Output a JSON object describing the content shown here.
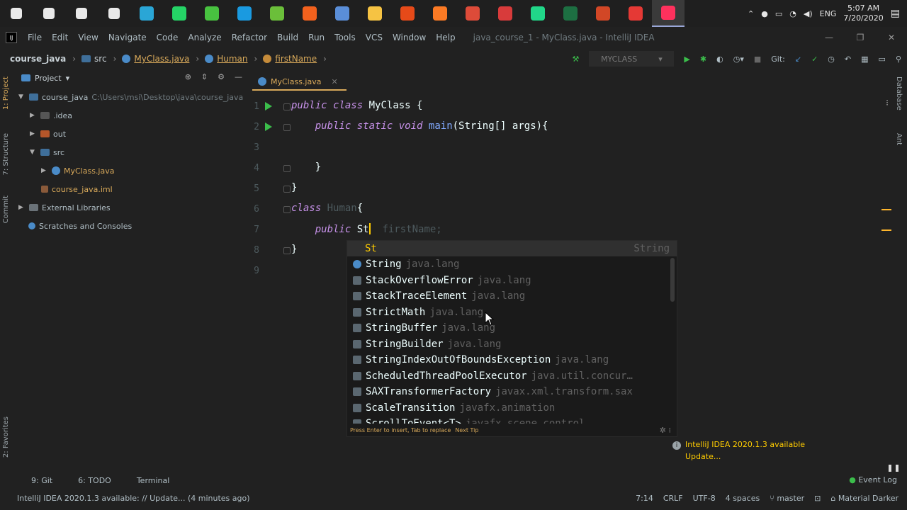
{
  "taskbar": {
    "apps": [
      {
        "name": "windows-start-icon",
        "color": "#ffffff"
      },
      {
        "name": "search-icon",
        "color": "#ffffff"
      },
      {
        "name": "cortana-icon",
        "color": "#ffffff"
      },
      {
        "name": "task-view-icon",
        "color": "#ffffff"
      },
      {
        "name": "app-e-icon",
        "color": "#2aa6d6"
      },
      {
        "name": "whatsapp-icon",
        "color": "#25d366"
      },
      {
        "name": "app-ring-icon",
        "color": "#48c240"
      },
      {
        "name": "skype-icon",
        "color": "#1a9ae0"
      },
      {
        "name": "app-green-icon",
        "color": "#6bbf3a"
      },
      {
        "name": "app-orange-icon",
        "color": "#f2611d"
      },
      {
        "name": "app-cube-icon",
        "color": "#5a8ed8"
      },
      {
        "name": "file-explorer-icon",
        "color": "#f6c343"
      },
      {
        "name": "office-icon",
        "color": "#e64a19"
      },
      {
        "name": "xampp-icon",
        "color": "#fb7a24"
      },
      {
        "name": "chrome-icon",
        "color": "#dd4b39"
      },
      {
        "name": "app-bolt-icon",
        "color": "#d83b3b"
      },
      {
        "name": "webstorm-icon",
        "color": "#21d789"
      },
      {
        "name": "excel-icon",
        "color": "#1d6f42"
      },
      {
        "name": "powerpoint-icon",
        "color": "#d24726"
      },
      {
        "name": "app-red-icon",
        "color": "#e53935"
      },
      {
        "name": "intellij-icon",
        "color": "#fe315d"
      }
    ],
    "language": "ENG",
    "time": "5:07 AM",
    "date": "7/20/2020"
  },
  "menubar": {
    "items": [
      "File",
      "Edit",
      "View",
      "Navigate",
      "Code",
      "Analyze",
      "Refactor",
      "Build",
      "Run",
      "Tools",
      "VCS",
      "Window",
      "Help"
    ],
    "window_title": "java_course_1 - MyClass.java - IntelliJ IDEA"
  },
  "navbar": {
    "crumbs": [
      "course_java",
      "src",
      "MyClass.java",
      "Human",
      "firstName"
    ],
    "run_config": "MYCLASS",
    "git_label": "Git:"
  },
  "left_tabs": [
    "1: Project",
    "7: Structure",
    "Commit",
    "2: Favorites"
  ],
  "right_tabs": [
    "Database",
    "Ant"
  ],
  "project": {
    "title": "Project",
    "root_name": "course_java",
    "root_path": "C:\\Users\\msi\\Desktop\\java\\course_java",
    "nodes": [
      ".idea",
      "out",
      "src",
      "MyClass.java",
      "course_java.iml",
      "External Libraries",
      "Scratches and Consoles"
    ]
  },
  "editor": {
    "tab": "MyClass.java",
    "line_numbers": [
      "1",
      "2",
      "3",
      "4",
      "5",
      "6",
      "7",
      "8",
      "9"
    ],
    "code": {
      "l1_kw1": "public",
      "l1_kw2": "class",
      "l1_rest": " MyClass {",
      "l2_kw1": "public",
      "l2_kw2": "static",
      "l2_kw3": "void",
      "l2_fn": "main",
      "l2_rest": "(String[] args){",
      "l4": "}",
      "l5": "}",
      "l6_kw": "class",
      "l6_name": "Human",
      "l6_rest": "{",
      "l7_kw": "public",
      "l7_typed": "St",
      "l7_hint": "firstName;",
      "l8": "}"
    }
  },
  "completion": {
    "typed": "St",
    "typed_type": "String",
    "items": [
      {
        "name": "String",
        "pkg": "java.lang"
      },
      {
        "name": "StackOverflowError",
        "pkg": "java.lang"
      },
      {
        "name": "StackTraceElement",
        "pkg": "java.lang"
      },
      {
        "name": "StrictMath",
        "pkg": "java.lang"
      },
      {
        "name": "StringBuffer",
        "pkg": "java.lang"
      },
      {
        "name": "StringBuilder",
        "pkg": "java.lang"
      },
      {
        "name": "StringIndexOutOfBoundsException",
        "pkg": "java.lang"
      },
      {
        "name": "ScheduledThreadPoolExecutor",
        "pkg": "java.util.concur…"
      },
      {
        "name": "SAXTransformerFactory",
        "pkg": "javax.xml.transform.sax"
      },
      {
        "name": "ScaleTransition",
        "pkg": "javafx.animation"
      },
      {
        "name": "ScrollToEvent<T>",
        "pkg": "javafx.scene.control"
      }
    ],
    "footer_hint": "Press Enter to insert, Tab to replace",
    "footer_link": "Next Tip"
  },
  "notification": {
    "title": "IntelliJ IDEA 2020.1.3 available",
    "action": "Update..."
  },
  "bottom_tools": [
    "9: Git",
    "6: TODO",
    "Terminal"
  ],
  "event_log": "Event Log",
  "status": {
    "message": "IntelliJ IDEA 2020.1.3 available: // Update... (4 minutes ago)",
    "position": "7:14",
    "line_sep": "CRLF",
    "encoding": "UTF-8",
    "indent": "4 spaces",
    "branch": "master",
    "theme": "Material Darker"
  }
}
